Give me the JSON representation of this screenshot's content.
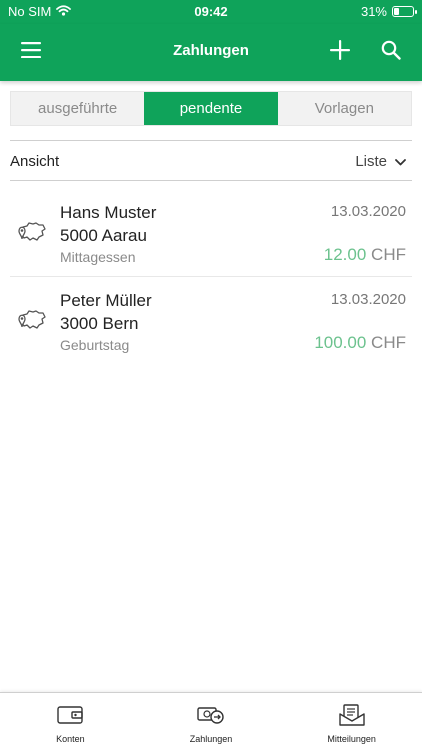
{
  "status_bar": {
    "carrier": "No SIM",
    "time": "09:42",
    "battery_percent": "31%",
    "battery_level": 0.31
  },
  "header": {
    "title": "Zahlungen",
    "menu_icon": "hamburger-menu-icon",
    "add_icon": "plus-icon",
    "search_icon": "search-icon"
  },
  "segments": [
    {
      "label": "ausgeführte",
      "active": false
    },
    {
      "label": "pendente",
      "active": true
    },
    {
      "label": "Vorlagen",
      "active": false
    }
  ],
  "view": {
    "label": "Ansicht",
    "selected": "Liste"
  },
  "payments": [
    {
      "name": "Hans Muster",
      "city": "5000 Aarau",
      "note": "Mittagessen",
      "date": "13.03.2020",
      "amount": "12.00",
      "currency": "CHF",
      "icon": "switzerland-location-icon"
    },
    {
      "name": "Peter Müller",
      "city": "3000 Bern",
      "note": "Geburtstag",
      "date": "13.03.2020",
      "amount": "100.00",
      "currency": "CHF",
      "icon": "switzerland-location-icon"
    }
  ],
  "tabbar": [
    {
      "label": "Konten",
      "icon": "wallet-icon"
    },
    {
      "label": "Zahlungen",
      "icon": "payment-transfer-icon"
    },
    {
      "label": "Mitteilungen",
      "icon": "messages-icon"
    }
  ],
  "colors": {
    "brand_green": "#0fa35a",
    "amount_green": "#6cc28e",
    "muted_text": "#8a8a8a"
  }
}
